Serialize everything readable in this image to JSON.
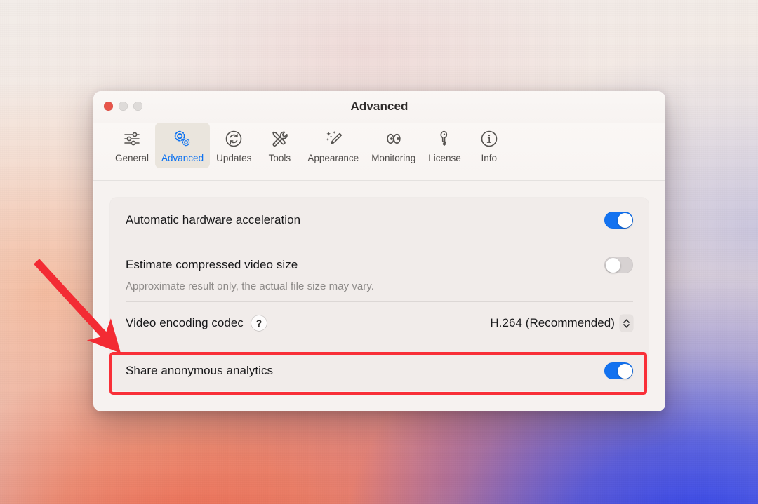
{
  "window": {
    "title": "Advanced",
    "traffic_lights": [
      {
        "name": "close",
        "color": "#e8554a"
      },
      {
        "name": "minimize",
        "color": "#dedbd9"
      },
      {
        "name": "maximize",
        "color": "#dedbd9"
      }
    ]
  },
  "toolbar": {
    "selected": "Advanced",
    "items": [
      {
        "label": "General",
        "icon": "sliders-icon"
      },
      {
        "label": "Advanced",
        "icon": "gears-icon"
      },
      {
        "label": "Updates",
        "icon": "refresh-circle-icon"
      },
      {
        "label": "Tools",
        "icon": "screwdriver-wrench-icon"
      },
      {
        "label": "Appearance",
        "icon": "magic-wand-sparkles-icon"
      },
      {
        "label": "Monitoring",
        "icon": "eyes-icon"
      },
      {
        "label": "License",
        "icon": "key-icon"
      },
      {
        "label": "Info",
        "icon": "info-circle-icon"
      }
    ]
  },
  "settings": {
    "rows": [
      {
        "label": "Automatic hardware acceleration",
        "control": "toggle",
        "value": "on"
      },
      {
        "label": "Estimate compressed video size",
        "sublabel": "Approximate result only, the actual file size may vary.",
        "control": "toggle",
        "value": "off"
      },
      {
        "label": "Video encoding codec",
        "help_glyph": "?",
        "control": "popup",
        "value": "H.264 (Recommended)"
      },
      {
        "label": "Share anonymous analytics",
        "control": "toggle",
        "value": "on",
        "highlighted": "true"
      }
    ]
  },
  "annotations": {
    "highlight_color": "#f92f38",
    "arrow_color": "#f32b33",
    "arrow_target": "Share anonymous analytics"
  },
  "colors": {
    "accent_blue": "#1372f0",
    "toolbar_selected_text": "#0a70f0",
    "toggle_off": "#d7d2d2",
    "window_bg": "#f6f2f0",
    "card_bg": "#f1ecea"
  }
}
